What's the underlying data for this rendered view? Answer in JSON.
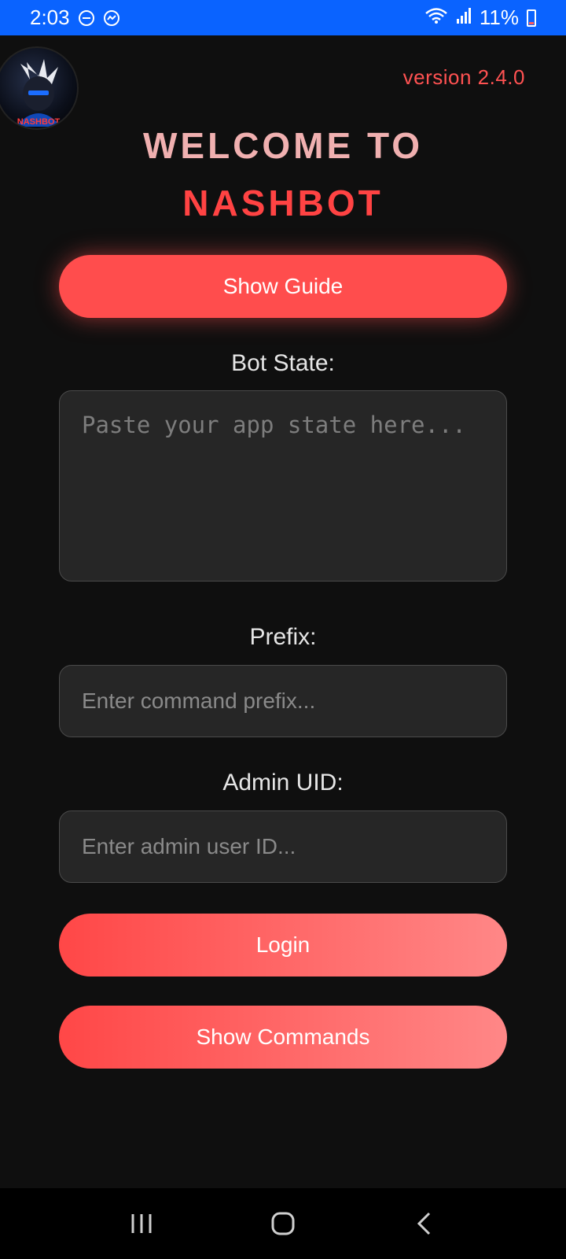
{
  "status_bar": {
    "time": "2:03",
    "battery": "11%",
    "icons": [
      "do-not-disturb-icon",
      "messenger-icon",
      "wifi-icon",
      "signal-icon",
      "battery-icon"
    ]
  },
  "header": {
    "version": "version 2.4.0",
    "logo_name": "nashbot-logo"
  },
  "title": {
    "line1": "WELCOME TO",
    "line2": "NASHBOT"
  },
  "buttons": {
    "show_guide": "Show Guide",
    "login": "Login",
    "show_commands": "Show Commands"
  },
  "form": {
    "bot_state_label": "Bot State:",
    "bot_state_placeholder": "Paste your app state here...",
    "prefix_label": "Prefix:",
    "prefix_placeholder": "Enter command prefix...",
    "admin_label": "Admin UID:",
    "admin_placeholder": "Enter admin user ID..."
  },
  "colors": {
    "accent": "#ff4d4d",
    "status_bar": "#0a63ff",
    "background": "#0f0f0f",
    "title_line1": "#f0b0b0"
  },
  "nav_bar": {
    "icons": [
      "recent-apps-icon",
      "home-icon",
      "back-icon"
    ]
  }
}
